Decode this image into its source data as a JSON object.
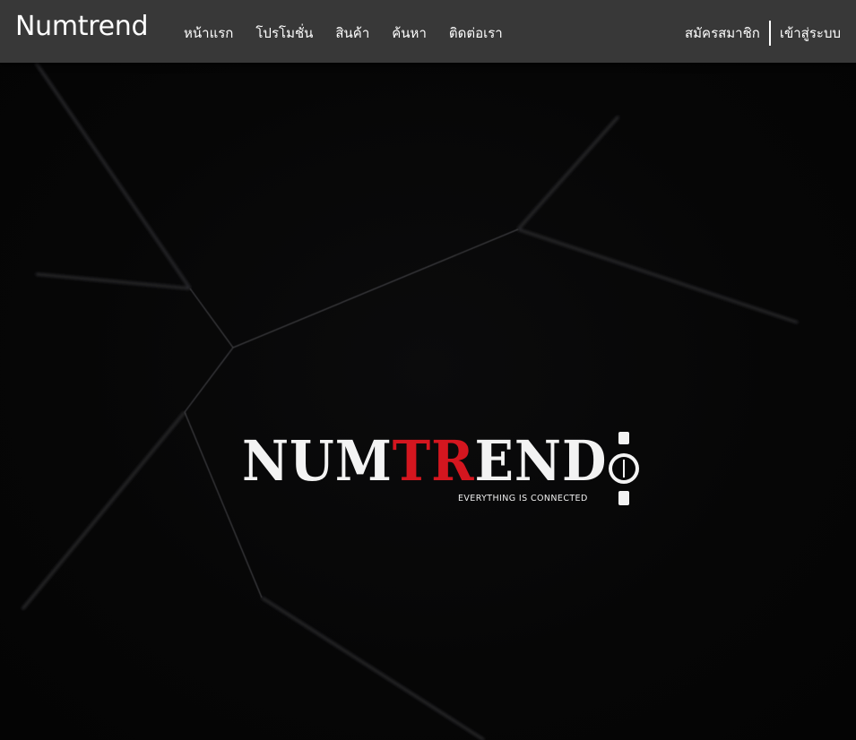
{
  "navbar": {
    "brand": "Numtrend",
    "links": [
      {
        "label": "หน้าแรก"
      },
      {
        "label": "โปรโมชั่น"
      },
      {
        "label": "สินค้า"
      },
      {
        "label": "ค้นหา"
      },
      {
        "label": "ติดต่อเรา"
      }
    ],
    "register_label": "สมัครสมาชิก",
    "login_label": "เข้าสู่ระบบ"
  },
  "hero": {
    "logo": {
      "word_part_1": "NUM",
      "word_part_2": "TR",
      "word_part_3": "END",
      "tagline": "EVERYTHING IS CONNECTED",
      "accent_color": "#d4161f"
    },
    "background_color": "#060606"
  },
  "colors": {
    "navbar_bg": "#383838",
    "text": "#ffffff"
  }
}
